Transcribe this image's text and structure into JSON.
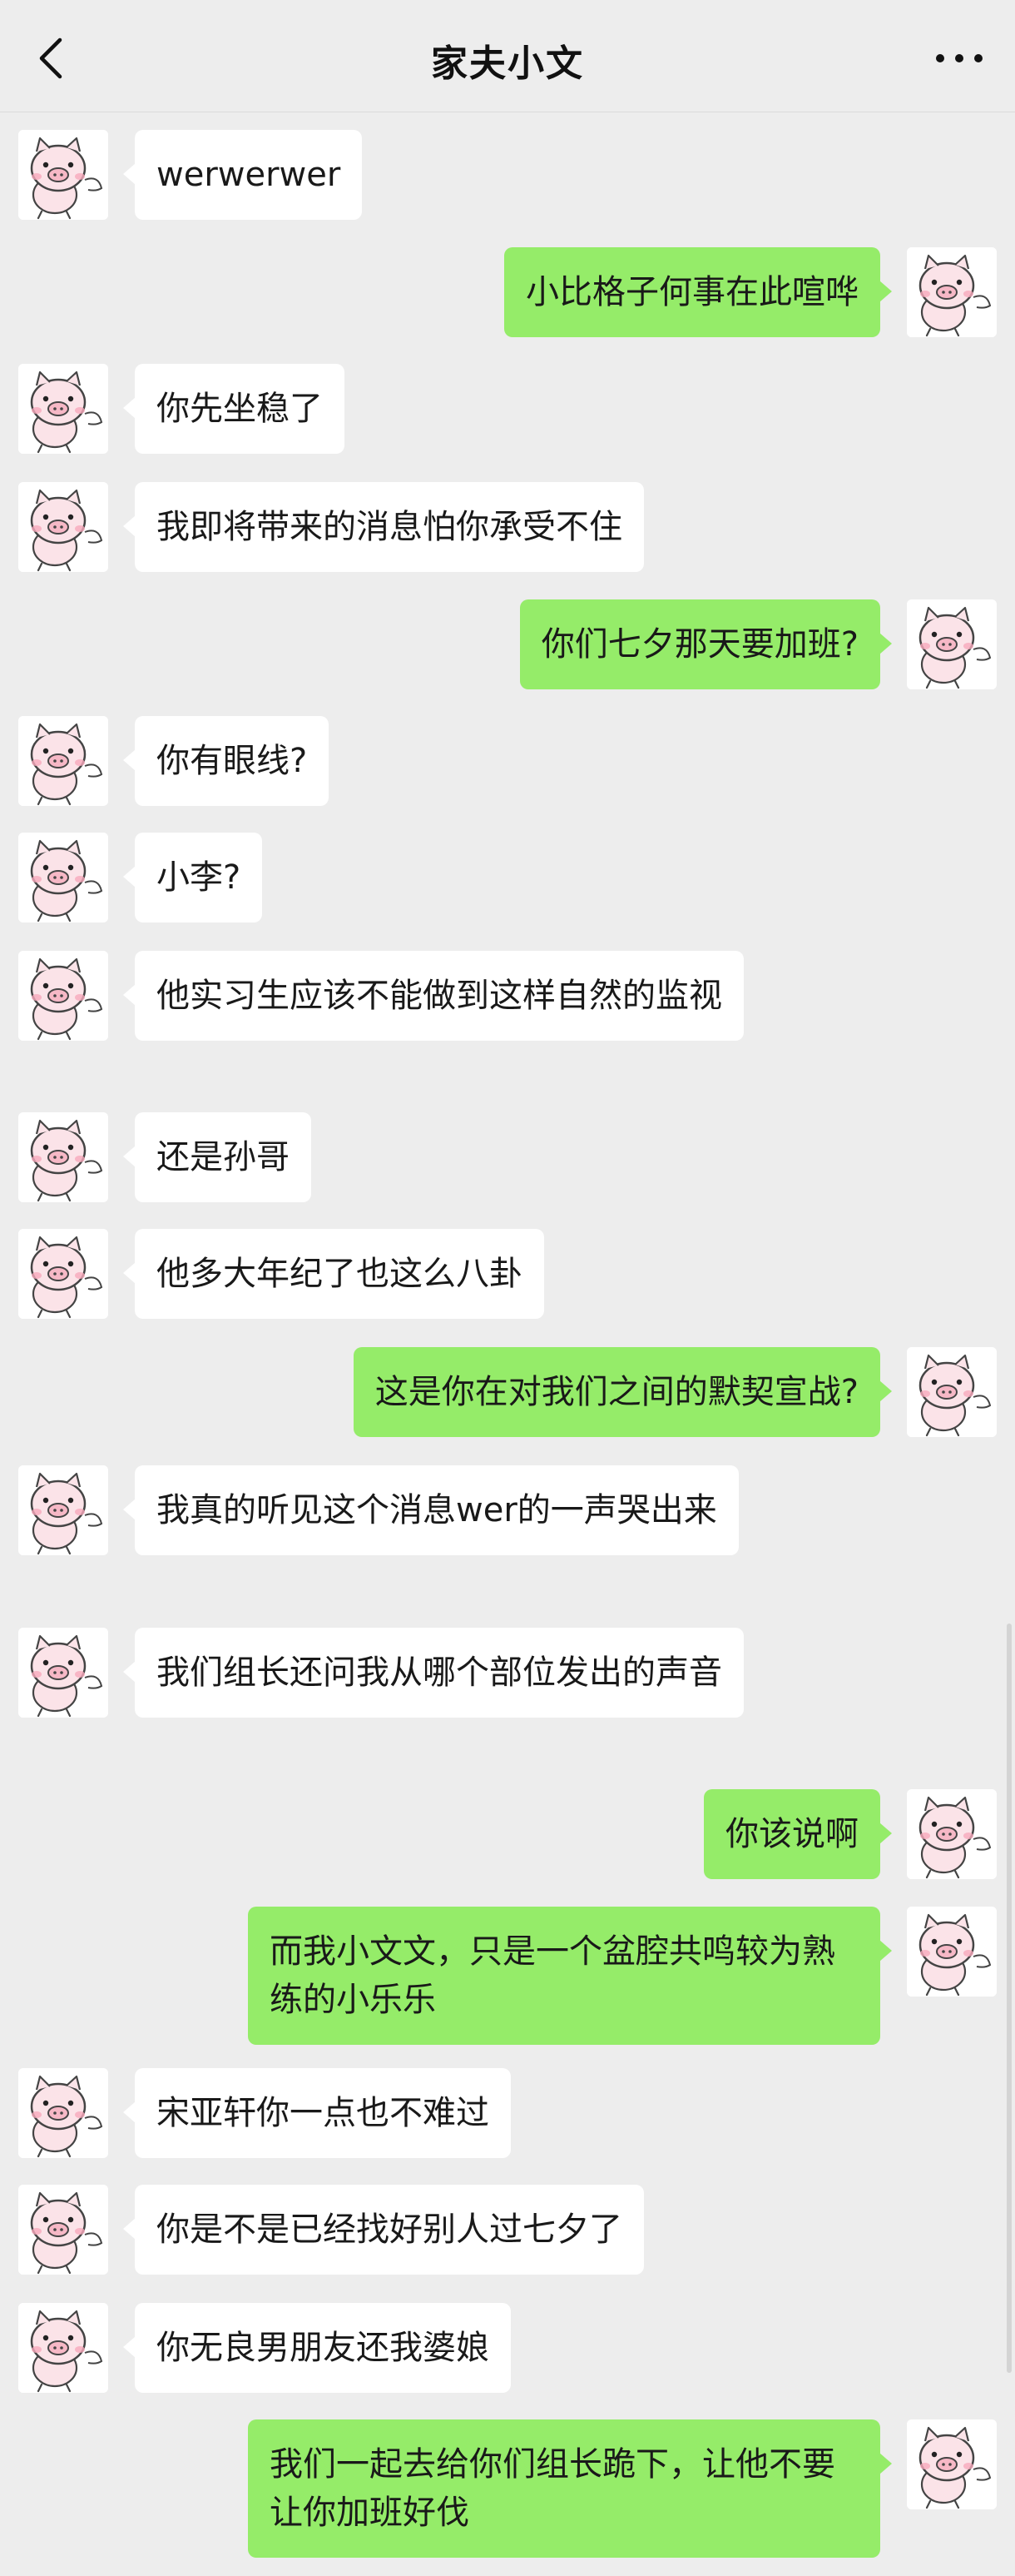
{
  "header": {
    "title": "家夫小文",
    "back_icon": "chevron-left-icon",
    "more_icon": "more-dots-icon"
  },
  "colors": {
    "background": "#ededed",
    "sent_bubble": "#95ec69",
    "received_bubble": "#ffffff"
  },
  "avatar_icon": "pink-pig-avatar-icon",
  "messages": [
    {
      "side": "left",
      "text": "werwerwer"
    },
    {
      "side": "right",
      "text": "小比格子何事在此喧哗"
    },
    {
      "side": "left",
      "text": "你先坐稳了"
    },
    {
      "side": "left",
      "text": "我即将带来的消息怕你承受不住"
    },
    {
      "side": "right",
      "text": "你们七夕那天要加班?"
    },
    {
      "side": "left",
      "text": "你有眼线?"
    },
    {
      "side": "left",
      "text": "小李?"
    },
    {
      "side": "left",
      "text": "他实习生应该不能做到这样自然的监视"
    },
    {
      "side": "left",
      "text": "还是孙哥"
    },
    {
      "side": "left",
      "text": "他多大年纪了也这么八卦"
    },
    {
      "side": "right",
      "text": "这是你在对我们之间的默契宣战?"
    },
    {
      "side": "left",
      "text": "我真的听见这个消息wer的一声哭出来"
    },
    {
      "side": "left",
      "text": "我们组长还问我从哪个部位发出的声音"
    },
    {
      "side": "right",
      "text": "你该说啊"
    },
    {
      "side": "right",
      "text": "而我小文文，只是一个盆腔共鸣较为熟练的小乐乐"
    },
    {
      "side": "left",
      "text": "宋亚轩你一点也不难过"
    },
    {
      "side": "left",
      "text": "你是不是已经找好别人过七夕了"
    },
    {
      "side": "left",
      "text": "你无良男朋友还我婆娘"
    },
    {
      "side": "right",
      "text": "我们一起去给你们组长跪下，让他不要让你加班好伐"
    }
  ]
}
